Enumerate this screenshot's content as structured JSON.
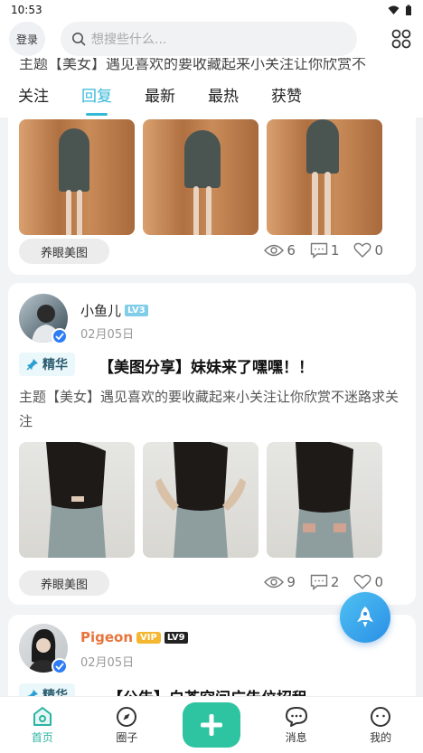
{
  "status": {
    "time": "10:53"
  },
  "header": {
    "login_label": "登录",
    "search_placeholder": "想搜些什么..."
  },
  "peek_text": "主题【美女】遇见喜欢的要收藏起来小关注让你欣赏不",
  "tabs": [
    {
      "label": "关注"
    },
    {
      "label": "回复",
      "active": true
    },
    {
      "label": "最新"
    },
    {
      "label": "最热"
    },
    {
      "label": "获赞"
    }
  ],
  "posts": [
    {
      "tag": "养眼美图",
      "views": "6",
      "comments": "1",
      "likes": "0"
    },
    {
      "username": "小鱼儿",
      "level": "LV3",
      "date": "02月05日",
      "badge": "精华",
      "title": "【美图分享】妹妹来了嘿嘿！！",
      "body": "主题【美女】遇见喜欢的要收藏起来小关注让你欣赏不迷路求关注",
      "tag": "养眼美图",
      "views": "9",
      "comments": "2",
      "likes": "0"
    },
    {
      "username": "Pigeon",
      "vip": "VIP",
      "level": "LV9",
      "date": "02月05日",
      "badge": "精华",
      "title": "【公告】白茶空间广告位招租"
    }
  ],
  "bottom_nav": [
    {
      "label": "首页",
      "active": true
    },
    {
      "label": "圈子"
    },
    {
      "label": ""
    },
    {
      "label": "消息"
    },
    {
      "label": "我的"
    }
  ],
  "colors": {
    "accent": "#36b8d8",
    "nav_active": "#2bb3a4",
    "plus_button": "#2ec3a1",
    "fab": "#2a8fe6",
    "pigeon_name": "#e8743b"
  }
}
